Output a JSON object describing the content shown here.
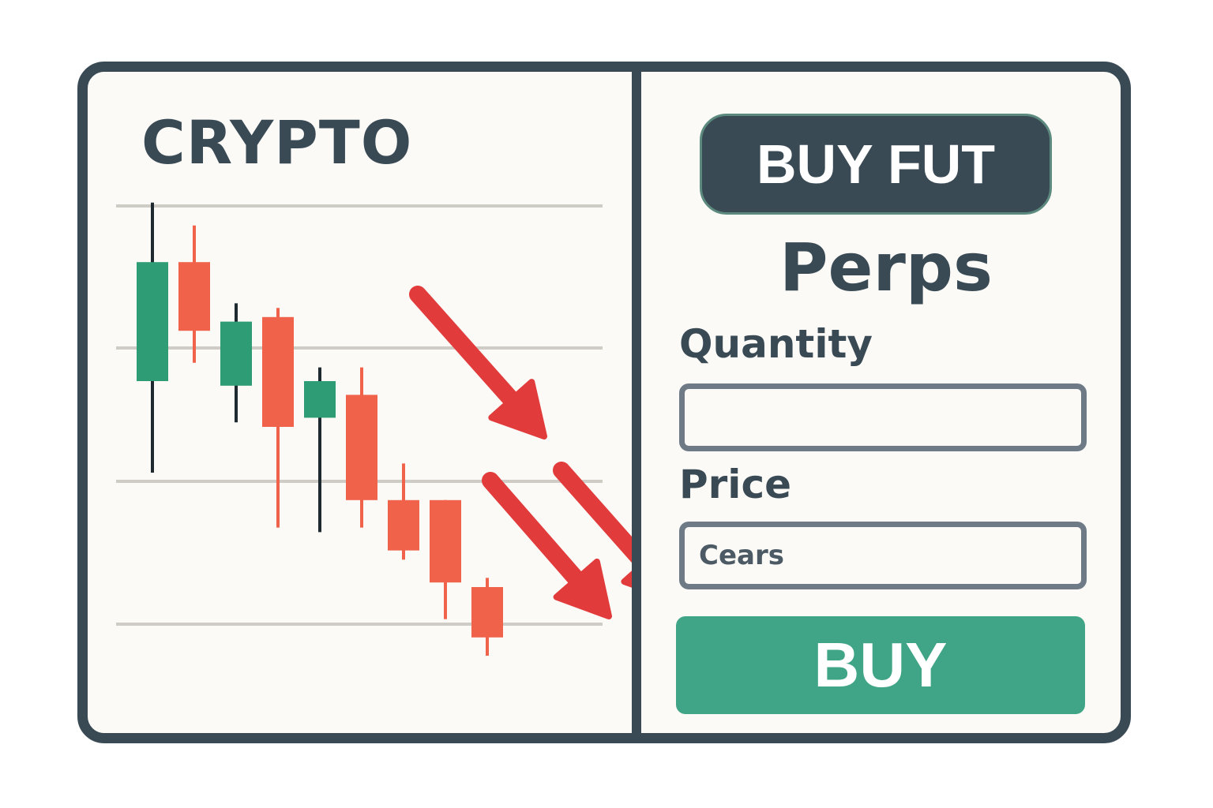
{
  "chart_panel": {
    "title": "CRYPTO",
    "trend": "down",
    "colors": {
      "up": "#2e9c74",
      "down": "#f0624a",
      "wick_up": "#1f2a30",
      "arrow": "#e23b3b",
      "grid": "#cfccc6"
    }
  },
  "chart_data": {
    "type": "candlestick",
    "title": "CRYPTO",
    "xlabel": "",
    "ylabel": "",
    "ylim": [
      0,
      100
    ],
    "grid": true,
    "candles": [
      {
        "open": 60,
        "high": 99,
        "low": 40,
        "close": 86,
        "dir": "up"
      },
      {
        "open": 86,
        "high": 94,
        "low": 64,
        "close": 71,
        "dir": "down"
      },
      {
        "open": 59,
        "high": 77,
        "low": 51,
        "close": 73,
        "dir": "up"
      },
      {
        "open": 74,
        "high": 76,
        "low": 28,
        "close": 50,
        "dir": "down"
      },
      {
        "open": 52,
        "high": 63,
        "low": 27,
        "close": 60,
        "dir": "up"
      },
      {
        "open": 57,
        "high": 63,
        "low": 28,
        "close": 34,
        "dir": "down"
      },
      {
        "open": 34,
        "high": 42,
        "low": 21,
        "close": 23,
        "dir": "down"
      },
      {
        "open": 34,
        "high": 34,
        "low": 8,
        "close": 16,
        "dir": "down"
      },
      {
        "open": 15,
        "high": 17,
        "low": 0,
        "close": 4,
        "dir": "down"
      }
    ]
  },
  "trade_panel": {
    "contract_button": "BUY FUT",
    "market_title": "Perps",
    "quantity": {
      "label": "Quantity",
      "value": ""
    },
    "price": {
      "label": "Price",
      "value": "Cears"
    },
    "buy_button": "BUY",
    "colors": {
      "primary": "#3a4a55",
      "buy": "#3fa586",
      "input_border": "#6e7b86"
    }
  }
}
